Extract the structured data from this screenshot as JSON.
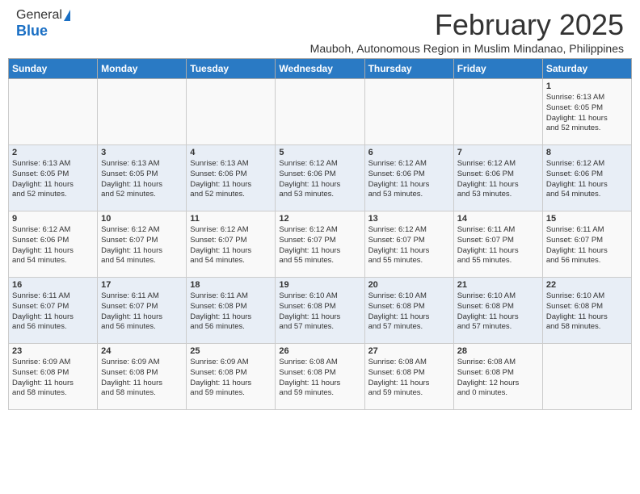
{
  "header": {
    "logo_line1": "General",
    "logo_line2": "Blue",
    "main_title": "February 2025",
    "subtitle": "Mauboh, Autonomous Region in Muslim Mindanao, Philippines"
  },
  "days_of_week": [
    "Sunday",
    "Monday",
    "Tuesday",
    "Wednesday",
    "Thursday",
    "Friday",
    "Saturday"
  ],
  "weeks": [
    {
      "days": [
        {
          "num": "",
          "info": ""
        },
        {
          "num": "",
          "info": ""
        },
        {
          "num": "",
          "info": ""
        },
        {
          "num": "",
          "info": ""
        },
        {
          "num": "",
          "info": ""
        },
        {
          "num": "",
          "info": ""
        },
        {
          "num": "1",
          "info": "Sunrise: 6:13 AM\nSunset: 6:05 PM\nDaylight: 11 hours\nand 52 minutes."
        }
      ]
    },
    {
      "days": [
        {
          "num": "2",
          "info": "Sunrise: 6:13 AM\nSunset: 6:05 PM\nDaylight: 11 hours\nand 52 minutes."
        },
        {
          "num": "3",
          "info": "Sunrise: 6:13 AM\nSunset: 6:05 PM\nDaylight: 11 hours\nand 52 minutes."
        },
        {
          "num": "4",
          "info": "Sunrise: 6:13 AM\nSunset: 6:06 PM\nDaylight: 11 hours\nand 52 minutes."
        },
        {
          "num": "5",
          "info": "Sunrise: 6:12 AM\nSunset: 6:06 PM\nDaylight: 11 hours\nand 53 minutes."
        },
        {
          "num": "6",
          "info": "Sunrise: 6:12 AM\nSunset: 6:06 PM\nDaylight: 11 hours\nand 53 minutes."
        },
        {
          "num": "7",
          "info": "Sunrise: 6:12 AM\nSunset: 6:06 PM\nDaylight: 11 hours\nand 53 minutes."
        },
        {
          "num": "8",
          "info": "Sunrise: 6:12 AM\nSunset: 6:06 PM\nDaylight: 11 hours\nand 54 minutes."
        }
      ]
    },
    {
      "days": [
        {
          "num": "9",
          "info": "Sunrise: 6:12 AM\nSunset: 6:06 PM\nDaylight: 11 hours\nand 54 minutes."
        },
        {
          "num": "10",
          "info": "Sunrise: 6:12 AM\nSunset: 6:07 PM\nDaylight: 11 hours\nand 54 minutes."
        },
        {
          "num": "11",
          "info": "Sunrise: 6:12 AM\nSunset: 6:07 PM\nDaylight: 11 hours\nand 54 minutes."
        },
        {
          "num": "12",
          "info": "Sunrise: 6:12 AM\nSunset: 6:07 PM\nDaylight: 11 hours\nand 55 minutes."
        },
        {
          "num": "13",
          "info": "Sunrise: 6:12 AM\nSunset: 6:07 PM\nDaylight: 11 hours\nand 55 minutes."
        },
        {
          "num": "14",
          "info": "Sunrise: 6:11 AM\nSunset: 6:07 PM\nDaylight: 11 hours\nand 55 minutes."
        },
        {
          "num": "15",
          "info": "Sunrise: 6:11 AM\nSunset: 6:07 PM\nDaylight: 11 hours\nand 56 minutes."
        }
      ]
    },
    {
      "days": [
        {
          "num": "16",
          "info": "Sunrise: 6:11 AM\nSunset: 6:07 PM\nDaylight: 11 hours\nand 56 minutes."
        },
        {
          "num": "17",
          "info": "Sunrise: 6:11 AM\nSunset: 6:07 PM\nDaylight: 11 hours\nand 56 minutes."
        },
        {
          "num": "18",
          "info": "Sunrise: 6:11 AM\nSunset: 6:08 PM\nDaylight: 11 hours\nand 56 minutes."
        },
        {
          "num": "19",
          "info": "Sunrise: 6:10 AM\nSunset: 6:08 PM\nDaylight: 11 hours\nand 57 minutes."
        },
        {
          "num": "20",
          "info": "Sunrise: 6:10 AM\nSunset: 6:08 PM\nDaylight: 11 hours\nand 57 minutes."
        },
        {
          "num": "21",
          "info": "Sunrise: 6:10 AM\nSunset: 6:08 PM\nDaylight: 11 hours\nand 57 minutes."
        },
        {
          "num": "22",
          "info": "Sunrise: 6:10 AM\nSunset: 6:08 PM\nDaylight: 11 hours\nand 58 minutes."
        }
      ]
    },
    {
      "days": [
        {
          "num": "23",
          "info": "Sunrise: 6:09 AM\nSunset: 6:08 PM\nDaylight: 11 hours\nand 58 minutes."
        },
        {
          "num": "24",
          "info": "Sunrise: 6:09 AM\nSunset: 6:08 PM\nDaylight: 11 hours\nand 58 minutes."
        },
        {
          "num": "25",
          "info": "Sunrise: 6:09 AM\nSunset: 6:08 PM\nDaylight: 11 hours\nand 59 minutes."
        },
        {
          "num": "26",
          "info": "Sunrise: 6:08 AM\nSunset: 6:08 PM\nDaylight: 11 hours\nand 59 minutes."
        },
        {
          "num": "27",
          "info": "Sunrise: 6:08 AM\nSunset: 6:08 PM\nDaylight: 11 hours\nand 59 minutes."
        },
        {
          "num": "28",
          "info": "Sunrise: 6:08 AM\nSunset: 6:08 PM\nDaylight: 12 hours\nand 0 minutes."
        },
        {
          "num": "",
          "info": ""
        }
      ]
    }
  ]
}
